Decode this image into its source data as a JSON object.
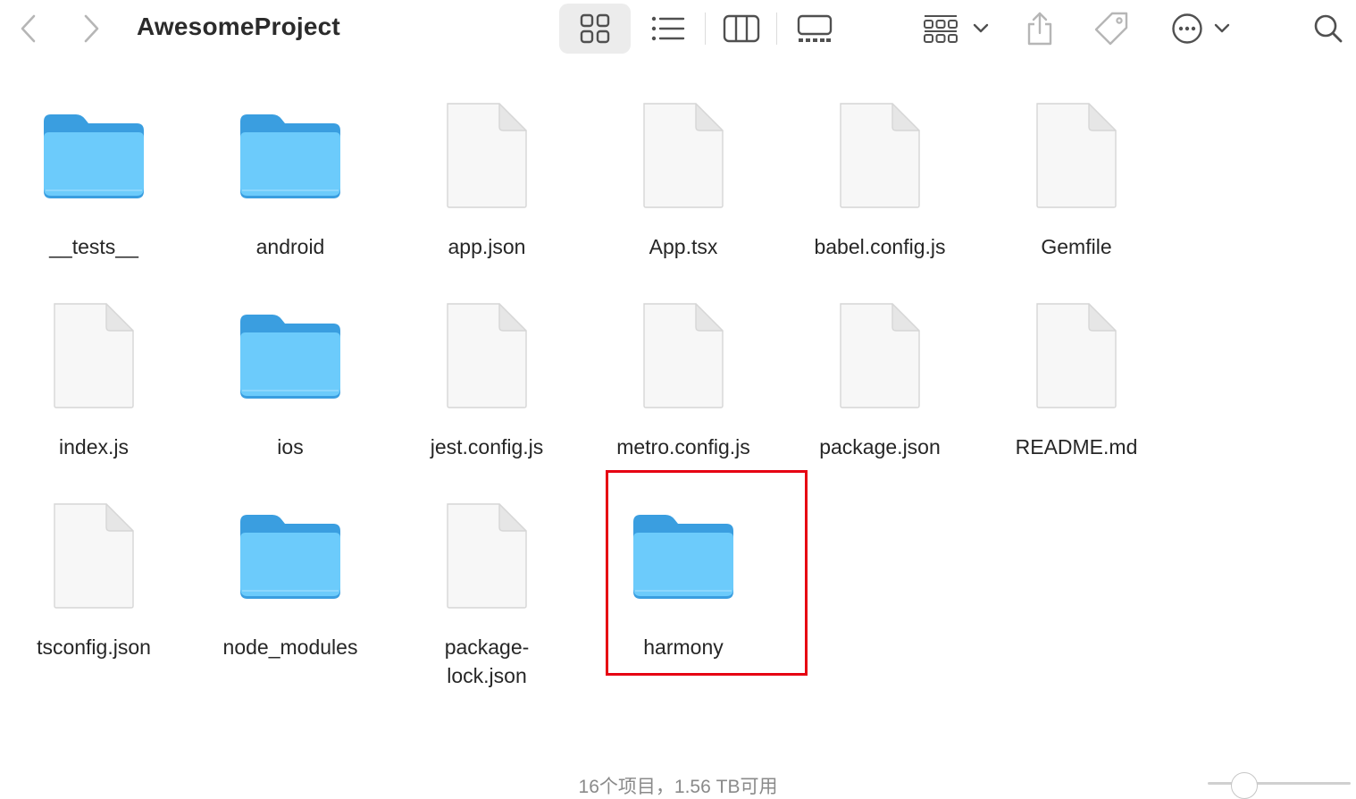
{
  "window": {
    "title": "AwesomeProject"
  },
  "toolbar": {
    "back_icon": "chevron-left-icon",
    "forward_icon": "chevron-right-icon",
    "views": [
      {
        "name": "icon-view",
        "icon": "grid-icon",
        "active": true
      },
      {
        "name": "list-view",
        "icon": "list-icon",
        "active": false
      },
      {
        "name": "column-view",
        "icon": "columns-icon",
        "active": false
      },
      {
        "name": "gallery-view",
        "icon": "gallery-icon",
        "active": false
      }
    ],
    "group_icon": "group-icon",
    "share_icon": "share-icon",
    "tag_icon": "tag-icon",
    "more_icon": "ellipsis-circle-icon",
    "search_icon": "search-icon"
  },
  "items": [
    {
      "name": "__tests__",
      "kind": "folder"
    },
    {
      "name": "android",
      "kind": "folder"
    },
    {
      "name": "app.json",
      "kind": "file"
    },
    {
      "name": "App.tsx",
      "kind": "file"
    },
    {
      "name": "babel.config.js",
      "kind": "file"
    },
    {
      "name": "Gemfile",
      "kind": "file"
    },
    {
      "name": "index.js",
      "kind": "file"
    },
    {
      "name": "ios",
      "kind": "folder"
    },
    {
      "name": "jest.config.js",
      "kind": "file"
    },
    {
      "name": "metro.config.js",
      "kind": "file"
    },
    {
      "name": "package.json",
      "kind": "file"
    },
    {
      "name": "README.md",
      "kind": "file"
    },
    {
      "name": "tsconfig.json",
      "kind": "file"
    },
    {
      "name": "node_modules",
      "kind": "folder"
    },
    {
      "name": "package-\nlock.json",
      "kind": "file"
    },
    {
      "name": "harmony",
      "kind": "folder",
      "highlighted": true
    }
  ],
  "colors": {
    "folder_front": "#6ccbfb",
    "folder_back": "#3a9ee0",
    "highlight": "#e60012",
    "active_view_bg": "#ececec"
  },
  "status": {
    "text": "16个项目，1.56 TB可用"
  }
}
